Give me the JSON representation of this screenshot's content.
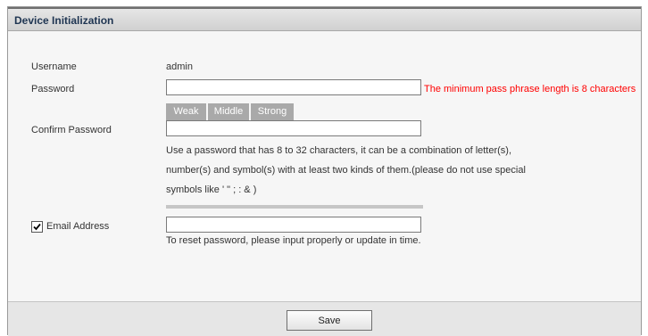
{
  "dialog": {
    "title": "Device Initialization"
  },
  "form": {
    "username_label": "Username",
    "username_value": "admin",
    "password_label": "Password",
    "password_value": "",
    "password_error": "The minimum pass phrase length is 8 characters",
    "strength_levels": [
      "Weak",
      "Middle",
      "Strong"
    ],
    "confirm_label": "Confirm Password",
    "confirm_value": "",
    "hint_lines": [
      "Use a password that has 8 to 32 characters, it can be a combination of letter(s),",
      "number(s) and symbol(s) with at least two kinds of them.(please do not use special",
      "symbols like ' \" ; : & )"
    ],
    "email_checkbox_checked": true,
    "email_label": "Email Address",
    "email_value": "",
    "email_hint": "To reset password, please input properly or update in time."
  },
  "footer": {
    "save_label": "Save"
  },
  "colors": {
    "error": "#ff0000",
    "title_text": "#1f3552",
    "strength_segment": "#a9a9a9"
  }
}
